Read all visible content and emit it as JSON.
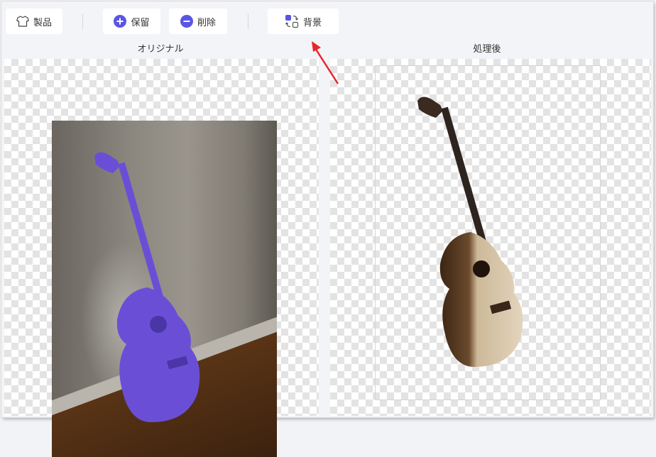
{
  "toolbar": {
    "product_label": "製品",
    "keep_label": "保留",
    "delete_label": "削除",
    "background_label": "背景"
  },
  "panels": {
    "original_label": "オリジナル",
    "processed_label": "処理後"
  },
  "icons": {
    "product": "tshirt-icon",
    "keep": "plus-circle-icon",
    "delete": "minus-circle-icon",
    "background": "swap-background-icon",
    "annotation": "red-arrow-icon"
  },
  "colors": {
    "accent": "#5a55e6",
    "guitar_mask": "#6a4fd6",
    "arrow": "#e8262b"
  }
}
